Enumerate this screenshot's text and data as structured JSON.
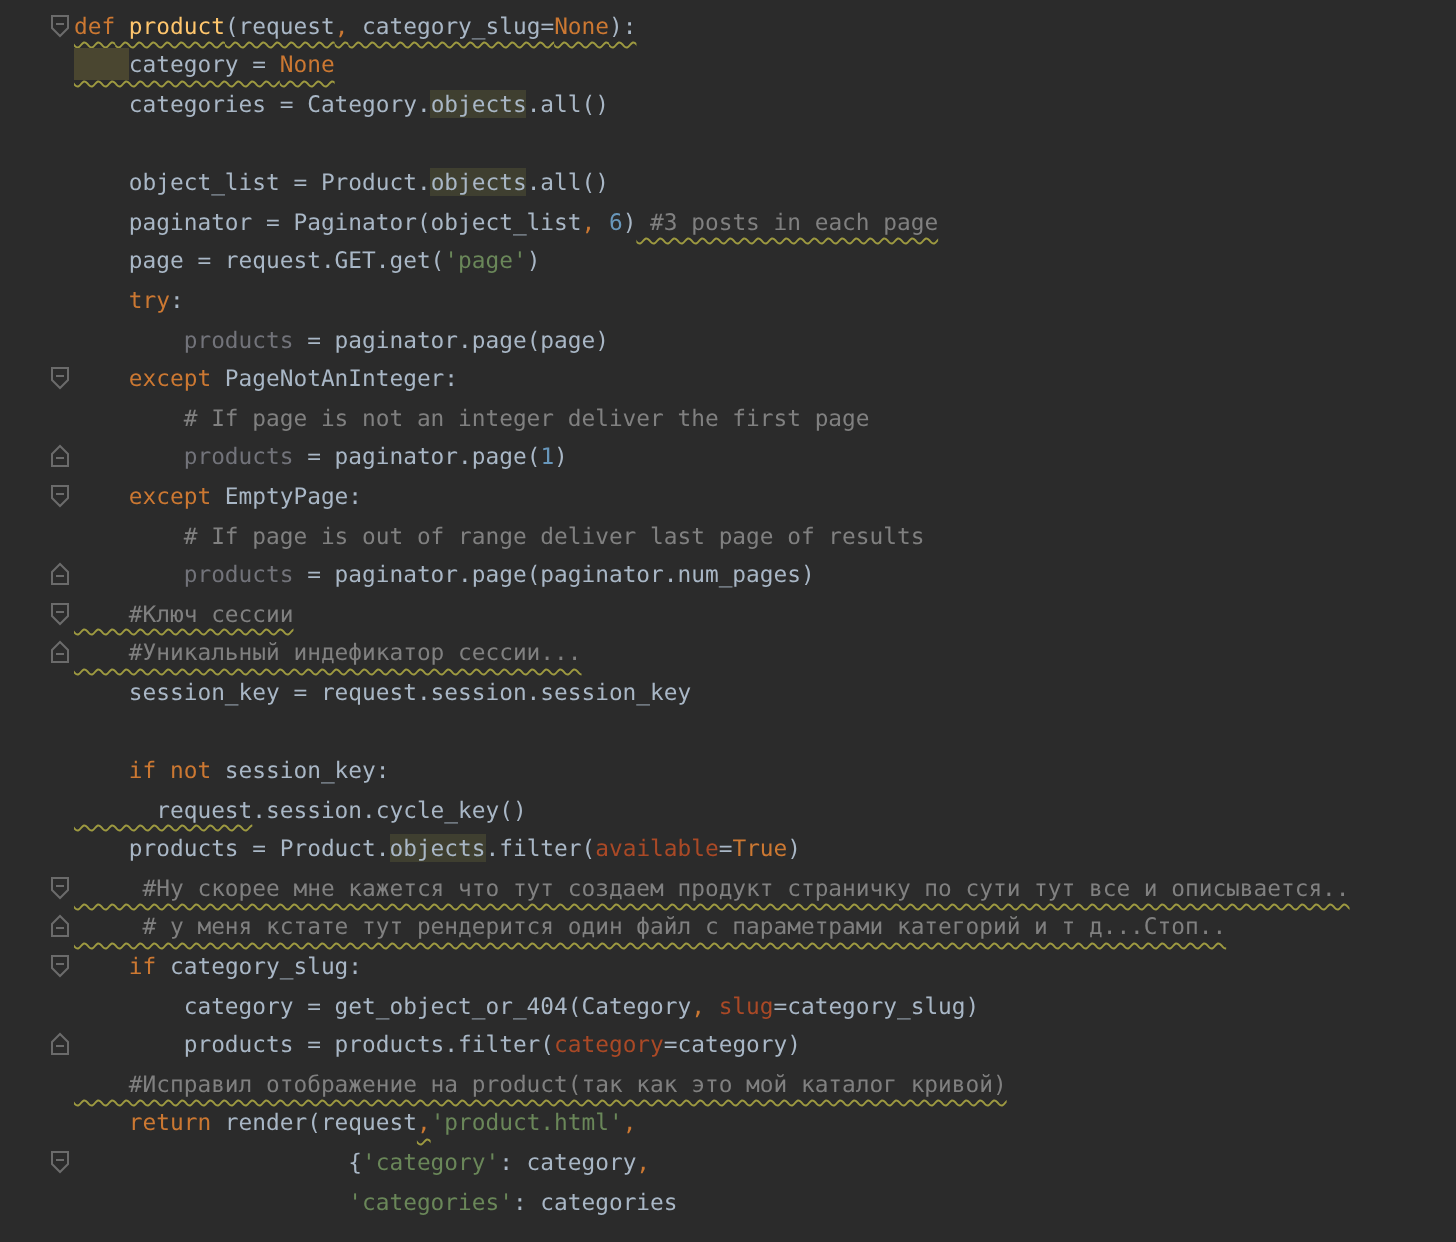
{
  "editor": {
    "lines": [
      {
        "kind": "fold-start",
        "tokens": [
          {
            "text": "def",
            "kind": "keyword",
            "warn": true
          },
          {
            "text": " product",
            "kind": "function",
            "warn": true
          },
          {
            "text": "(request",
            "kind": "plain",
            "warn": true
          },
          {
            "text": ",",
            "kind": "keyword",
            "warn": true
          },
          {
            "text": " category_slug=",
            "kind": "plain",
            "warn": true
          },
          {
            "text": "None",
            "kind": "keyword",
            "warn": true
          },
          {
            "text": "):",
            "kind": "plain",
            "warn": true
          }
        ]
      },
      {
        "kind": "code",
        "indent_warning": true,
        "tokens": [
          {
            "text": "    category = ",
            "kind": "plain",
            "warn": true
          },
          {
            "text": "None",
            "kind": "keyword",
            "warn": true
          }
        ]
      },
      {
        "kind": "code",
        "tokens": [
          {
            "text": "    categories = Category.",
            "kind": "plain"
          },
          {
            "text": "objects",
            "kind": "usage"
          },
          {
            "text": ".all()",
            "kind": "plain"
          }
        ]
      },
      {
        "kind": "code"
      },
      {
        "kind": "code",
        "tokens": [
          {
            "text": "    object_list = Product.",
            "kind": "plain"
          },
          {
            "text": "objects",
            "kind": "usage"
          },
          {
            "text": ".all()",
            "kind": "plain"
          }
        ]
      },
      {
        "kind": "code",
        "tokens": [
          {
            "text": "    paginator = Paginator(object_list",
            "kind": "plain"
          },
          {
            "text": ",",
            "kind": "keyword"
          },
          {
            "text": " 6",
            "kind": "number"
          },
          {
            "text": ")",
            "kind": "plain"
          },
          {
            "text": " #3 posts in each page",
            "kind": "comment",
            "warn": true
          }
        ]
      },
      {
        "kind": "code",
        "tokens": [
          {
            "text": "    page = request.GET.get(",
            "kind": "plain"
          },
          {
            "text": "'page'",
            "kind": "string"
          },
          {
            "text": ")",
            "kind": "plain"
          }
        ]
      },
      {
        "kind": "code",
        "tokens": [
          {
            "text": "    try",
            "kind": "keyword"
          },
          {
            "text": ":",
            "kind": "plain"
          }
        ]
      },
      {
        "kind": "code",
        "tokens": [
          {
            "text": "        products",
            "kind": "unused"
          },
          {
            "text": " = paginator.page(page)",
            "kind": "plain"
          }
        ]
      },
      {
        "kind": "fold-start",
        "tokens": [
          {
            "text": "    except",
            "kind": "keyword"
          },
          {
            "text": " PageNotAnInteger:",
            "kind": "plain"
          }
        ]
      },
      {
        "kind": "code",
        "tokens": [
          {
            "text": "        # If page is not an integer deliver the first page",
            "kind": "comment"
          }
        ]
      },
      {
        "kind": "fold-end",
        "tokens": [
          {
            "text": "        products",
            "kind": "unused"
          },
          {
            "text": " = paginator.page(",
            "kind": "plain"
          },
          {
            "text": "1",
            "kind": "number"
          },
          {
            "text": ")",
            "kind": "plain"
          }
        ]
      },
      {
        "kind": "fold-start",
        "tokens": [
          {
            "text": "    except",
            "kind": "keyword"
          },
          {
            "text": " EmptyPage:",
            "kind": "plain"
          }
        ]
      },
      {
        "kind": "code",
        "tokens": [
          {
            "text": "        # If page is out of range deliver last page of results",
            "kind": "comment"
          }
        ]
      },
      {
        "kind": "fold-end",
        "tokens": [
          {
            "text": "        products",
            "kind": "unused"
          },
          {
            "text": " = paginator.page(paginator.num_pages)",
            "kind": "plain"
          }
        ]
      },
      {
        "kind": "fold-start",
        "tokens": [
          {
            "text": "    #Ключ сессии",
            "kind": "comment",
            "warn": true
          }
        ]
      },
      {
        "kind": "fold-end",
        "tokens": [
          {
            "text": "    #Уникальный индефикатор сессии...",
            "kind": "comment",
            "warn": true
          }
        ]
      },
      {
        "kind": "code",
        "tokens": [
          {
            "text": "    session_key = request.session.session_key",
            "kind": "plain"
          }
        ]
      },
      {
        "kind": "code"
      },
      {
        "kind": "code",
        "tokens": [
          {
            "text": "    if not",
            "kind": "keyword"
          },
          {
            "text": " session_key:",
            "kind": "plain"
          }
        ]
      },
      {
        "kind": "code",
        "tokens": [
          {
            "text": "      request",
            "kind": "plain",
            "warn": true
          },
          {
            "text": ".session.cycle_key()",
            "kind": "plain"
          }
        ]
      },
      {
        "kind": "code",
        "tokens": [
          {
            "text": "    products = Product.",
            "kind": "plain"
          },
          {
            "text": "objects",
            "kind": "usage"
          },
          {
            "text": ".filter(",
            "kind": "plain"
          },
          {
            "text": "available",
            "kind": "param"
          },
          {
            "text": "=",
            "kind": "plain"
          },
          {
            "text": "True",
            "kind": "keyword"
          },
          {
            "text": ")",
            "kind": "plain"
          }
        ]
      },
      {
        "kind": "fold-start",
        "tokens": [
          {
            "text": "     #Ну скорее мне кажется что тут создаем продукт страничку по сути тут все и описывается..",
            "kind": "comment",
            "warn": true
          }
        ]
      },
      {
        "kind": "fold-end",
        "tokens": [
          {
            "text": "     # у меня кстате тут рендерится один файл с параметрами категорий и т д...Стоп..",
            "kind": "comment",
            "warn": true
          }
        ]
      },
      {
        "kind": "fold-start",
        "tokens": [
          {
            "text": "    if",
            "kind": "keyword"
          },
          {
            "text": " category_slug:",
            "kind": "plain"
          }
        ]
      },
      {
        "kind": "code",
        "tokens": [
          {
            "text": "        category = get_object_or_404(Category",
            "kind": "plain"
          },
          {
            "text": ",",
            "kind": "keyword"
          },
          {
            "text": " slug",
            "kind": "param"
          },
          {
            "text": "=category_slug)",
            "kind": "plain"
          }
        ]
      },
      {
        "kind": "fold-end",
        "tokens": [
          {
            "text": "        products = products.filter(",
            "kind": "plain"
          },
          {
            "text": "category",
            "kind": "param"
          },
          {
            "text": "=category)",
            "kind": "plain"
          }
        ]
      },
      {
        "kind": "code",
        "tokens": [
          {
            "text": "    #Исправил отображение на product(так как это мой каталог кривой)",
            "kind": "comment",
            "warn": true
          }
        ]
      },
      {
        "kind": "code",
        "tokens": [
          {
            "text": "    return",
            "kind": "keyword"
          },
          {
            "text": " render(request",
            "kind": "plain"
          },
          {
            "text": ",",
            "kind": "keyword",
            "warn": true
          },
          {
            "text": "'product.html'",
            "kind": "string"
          },
          {
            "text": ",",
            "kind": "keyword"
          }
        ]
      },
      {
        "kind": "fold-start",
        "tokens": [
          {
            "text": "                    {",
            "kind": "plain"
          },
          {
            "text": "'category'",
            "kind": "string"
          },
          {
            "text": ": category",
            "kind": "plain"
          },
          {
            "text": ",",
            "kind": "keyword"
          }
        ]
      },
      {
        "kind": "code",
        "tokens": [
          {
            "text": "                    'categories'",
            "kind": "string"
          },
          {
            "text": ": categories",
            "kind": "plain"
          }
        ]
      }
    ]
  }
}
